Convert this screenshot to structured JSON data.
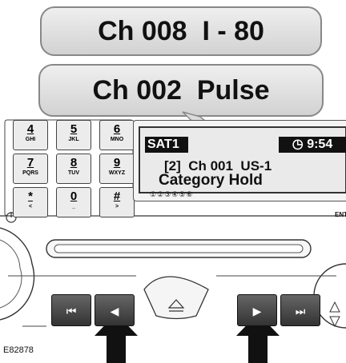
{
  "callouts": {
    "top": "Ch 008  I - 80",
    "main": "Ch 002  Pulse"
  },
  "keypad": [
    {
      "digit": "4",
      "letters": "GHI"
    },
    {
      "digit": "5",
      "letters": "JKL"
    },
    {
      "digit": "6",
      "letters": "MNO"
    },
    {
      "digit": "7",
      "letters": "PQRS"
    },
    {
      "digit": "8",
      "letters": "TUV"
    },
    {
      "digit": "9",
      "letters": "WXYZ"
    },
    {
      "digit": "*",
      "letters": "<"
    },
    {
      "digit": "0",
      "letters": "_"
    },
    {
      "digit": "#",
      "letters": ">"
    }
  ],
  "display": {
    "source": "SAT1",
    "time": "9:54",
    "line1": "[2]  Ch 001  US-1",
    "line2": "Category Hold",
    "presets": "①②③④⑤⑥"
  },
  "panel_label_right": "ENT",
  "figure_id": "E82878"
}
